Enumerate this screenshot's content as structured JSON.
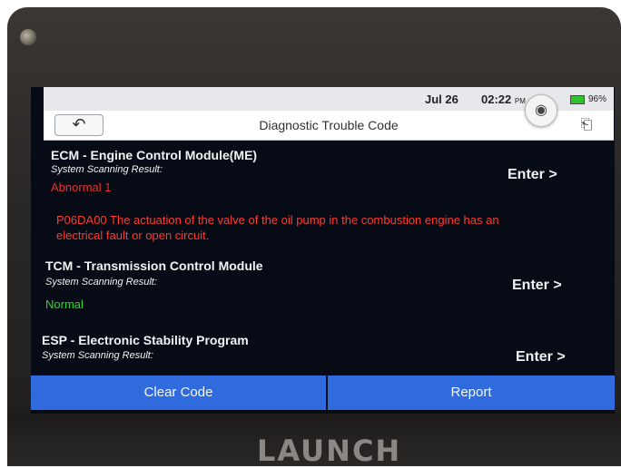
{
  "status_bar": {
    "date": "Jul 26",
    "time": "02:22",
    "meridiem": "PM",
    "battery_percent": "96%",
    "battery_icon": "battery-icon",
    "camera_icon": "camera-icon"
  },
  "titlebar": {
    "back_icon": "back-arrow-icon",
    "title": "Diagnostic Trouble Code",
    "exit_icon": "exit-icon"
  },
  "modules": [
    {
      "title": "ECM - Engine Control Module(ME)",
      "subtitle": "System Scanning Result:",
      "status": "Abnormal 1",
      "fault_line1": "P06DA00 The actuation of the valve of the oil pump in the combustion engine has an",
      "fault_line2": "electrical fault or open circuit.",
      "enter_label": "Enter >"
    },
    {
      "title": "TCM - Transmission Control Module",
      "subtitle": "System Scanning Result:",
      "status": "Normal",
      "enter_label": "Enter >"
    },
    {
      "title": "ESP - Electronic Stability Program",
      "subtitle": "System Scanning Result:",
      "enter_label": "Enter >"
    }
  ],
  "buttons": {
    "clear_code": "Clear Code",
    "report": "Report"
  },
  "device": {
    "brand": "LAUNCH"
  },
  "colors": {
    "accent_button": "#2f6bdc",
    "fault_red": "#ff3b30",
    "normal_green": "#2fd62c"
  }
}
